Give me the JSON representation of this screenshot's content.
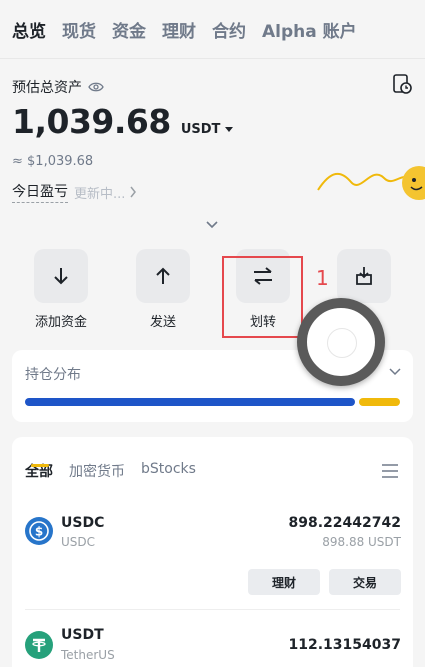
{
  "top_tabs": [
    "总览",
    "现货",
    "资金",
    "理财",
    "合约",
    "Alpha 账户"
  ],
  "asset": {
    "label": "预估总资产",
    "balance": "1,039.68",
    "currency": "USDT",
    "approx": "≈ $1,039.68",
    "pnl_label": "今日盈亏",
    "pnl_status": "更新中..."
  },
  "actions": [
    {
      "label": "添加资金",
      "icon": "arrow-down-icon"
    },
    {
      "label": "发送",
      "icon": "arrow-up-icon"
    },
    {
      "label": "划转",
      "icon": "transfer-icon"
    },
    {
      "label": "",
      "icon": "receive-icon"
    }
  ],
  "annotation": {
    "step": "1"
  },
  "distribution": {
    "title": "持仓分布",
    "usdc_share": 0.89,
    "usdt_share": 0.11,
    "colors": {
      "usdc": "#1e55c8",
      "usdt": "#f0b90b"
    }
  },
  "list": {
    "tabs": [
      "全部",
      "加密货币",
      "bStocks"
    ],
    "coins": [
      {
        "symbol": "USDC",
        "name": "USDC",
        "amount": "898.22442742",
        "value": "898.88 USDT",
        "actions": [
          "理财",
          "交易"
        ]
      },
      {
        "symbol": "USDT",
        "name": "TetherUS",
        "amount": "112.13154037",
        "value": ""
      }
    ]
  }
}
